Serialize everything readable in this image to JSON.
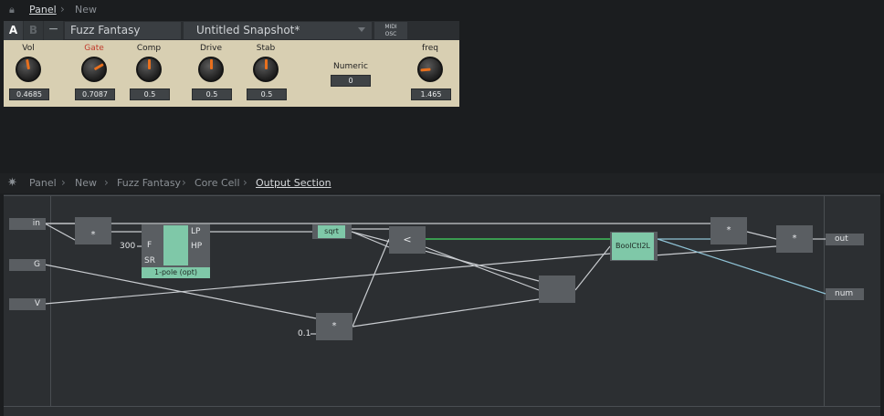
{
  "top_breadcrumb": {
    "items": [
      "Panel",
      "New"
    ]
  },
  "instrument": {
    "tabs": [
      "A",
      "B",
      "−"
    ],
    "name": "Fuzz Fantasy",
    "snapshot": "Untitled Snapshot*",
    "midi_label": "MIDI",
    "osc_label": "OSC",
    "knobs": [
      {
        "label": "Vol",
        "value": "0.4685"
      },
      {
        "label": "Gate",
        "value": "0.7087"
      },
      {
        "label": "Comp",
        "value": "0.5"
      },
      {
        "label": "Drive",
        "value": "0.5"
      },
      {
        "label": "Stab",
        "value": "0.5"
      },
      {
        "label": "freq",
        "value": "1.465"
      }
    ],
    "numeric": {
      "label": "Numeric",
      "value": "0"
    },
    "colors": {
      "panel": "#d8cfb2",
      "gate_label": "#c0392b",
      "knob_indicator": "#e8701e"
    }
  },
  "editor_breadcrumb": {
    "items": [
      "Panel",
      "New",
      "Fuzz Fantasy",
      "Core Cell",
      "Output Section"
    ]
  },
  "patch": {
    "inputs": [
      "in",
      "G",
      "V"
    ],
    "outputs": [
      "out",
      "num"
    ],
    "multiply_label": "*",
    "filter": {
      "name": "1-pole (opt)",
      "in_f": "F",
      "in_sr": "SR",
      "out_lp": "LP",
      "out_hp": "HP",
      "freq_const": "300"
    },
    "sqrt_label": "sqrt",
    "compare_label": "<",
    "boolctl_label": "BoolCtl2L",
    "const_small": "0.1",
    "colors": {
      "wire": "#c9ccd0",
      "green_wire": "#3fbf5a",
      "blue_wire": "#8fc3d6",
      "module": "#5a5e62",
      "module_green": "#7fc8a8"
    }
  }
}
